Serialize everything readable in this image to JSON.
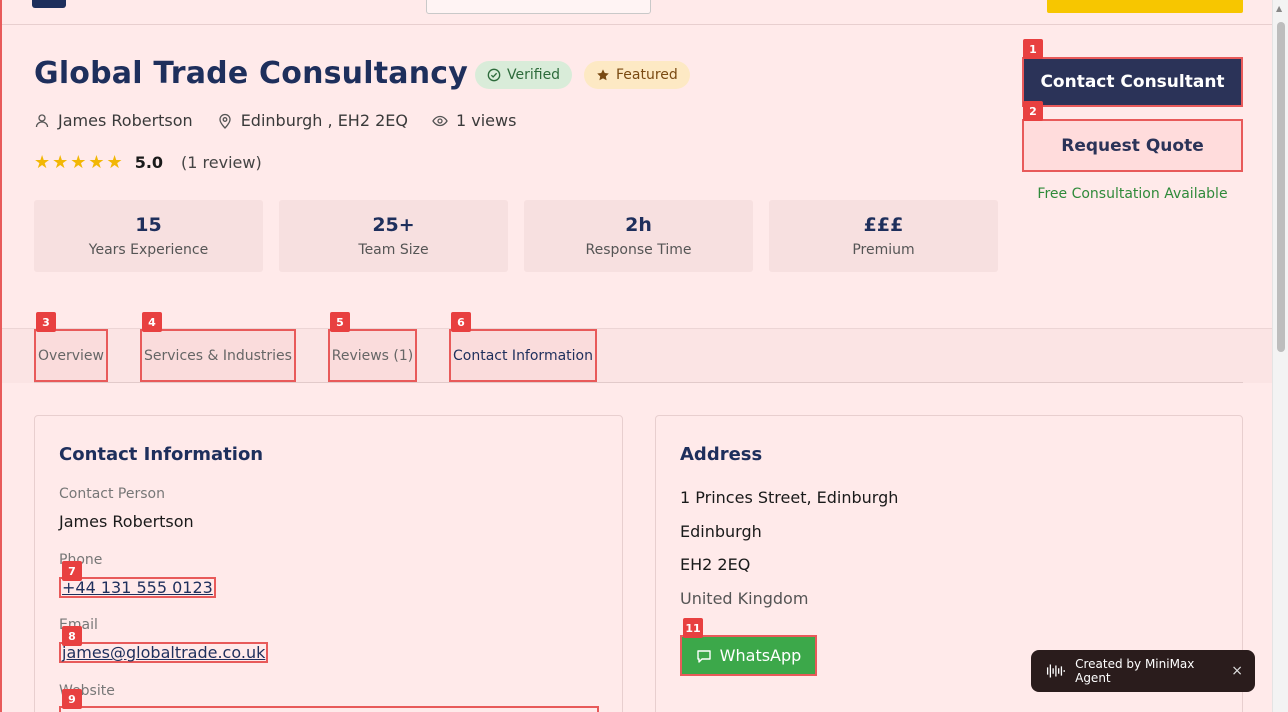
{
  "header": {
    "title": "Global Trade Consultancy",
    "badges": {
      "verified": "Verified",
      "featured": "Featured"
    }
  },
  "meta": {
    "contact_name": "James Robertson",
    "location": "Edinburgh  , EH2 2EQ",
    "views": "1 views"
  },
  "rating": {
    "stars": "★★★★★",
    "score": "5.0",
    "count": "(1 review)"
  },
  "stats": [
    {
      "value": "15",
      "label": "Years Experience"
    },
    {
      "value": "25+",
      "label": "Team Size"
    },
    {
      "value": "2h",
      "label": "Response Time"
    },
    {
      "value": "£££",
      "label": "Premium"
    }
  ],
  "actions": {
    "contact_label": "Contact Consultant",
    "quote_label": "Request Quote",
    "free_note": "Free Consultation Available"
  },
  "tabs": [
    {
      "label": "Overview"
    },
    {
      "label": "Services & Industries"
    },
    {
      "label": "Reviews (1)"
    },
    {
      "label": "Contact Information"
    }
  ],
  "contact": {
    "heading": "Contact Information",
    "person_label": "Contact Person",
    "person": "James Robertson",
    "phone_label": "Phone",
    "phone": "+44 131 555 0123",
    "email_label": "Email",
    "email": "james@globaltrade.co.uk",
    "website_label": "Website"
  },
  "address": {
    "heading": "Address",
    "line1": "1 Princes Street, Edinburgh",
    "city": "Edinburgh",
    "postcode": "EH2 2EQ",
    "country": "United Kingdom",
    "whatsapp_label": "WhatsApp"
  },
  "tags": [
    "1",
    "2",
    "3",
    "4",
    "5",
    "6",
    "7",
    "8",
    "9",
    "11"
  ],
  "toast": {
    "text": "Created by MiniMax Agent",
    "close": "×"
  },
  "colors": {
    "primary": "#1e2f5c",
    "accent": "#f7c600",
    "success": "#3ca84a",
    "highlight": "#e85a5a"
  }
}
